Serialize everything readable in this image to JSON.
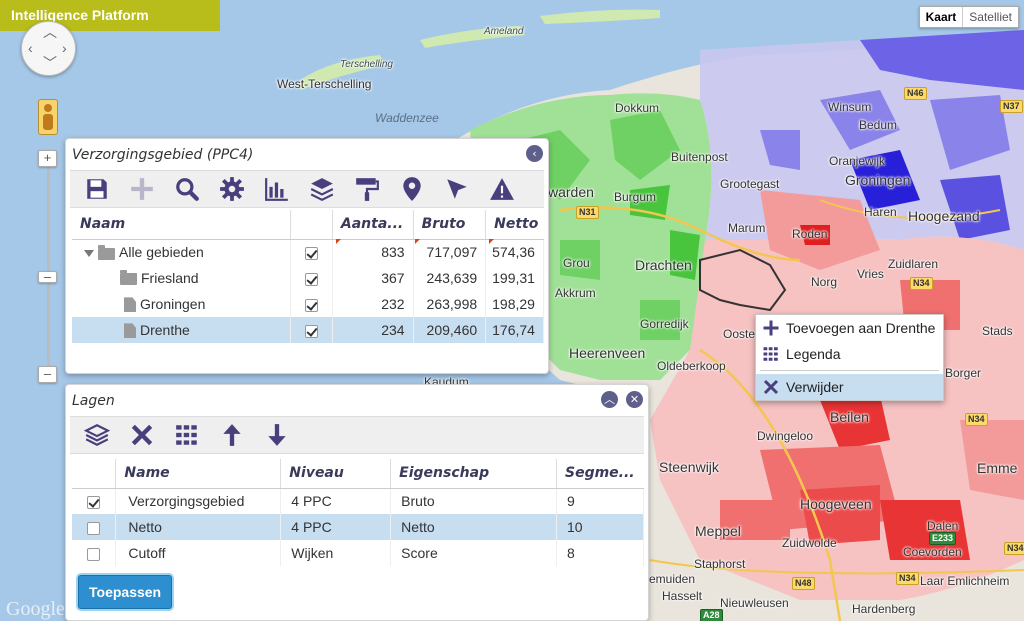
{
  "brand": "Intelligence Platform",
  "map_type": {
    "map": "Kaart",
    "satellite": "Satelliet",
    "selected": "Kaart"
  },
  "map_labels": {
    "ameland": "Ameland",
    "terschelling": "Terschelling",
    "west_terschelling": "West-Terschelling",
    "waddenzee": "Waddenzee",
    "dokkum": "Dokkum",
    "buitenpost": "Buitenpost",
    "grootegast": "Grootegast",
    "warden": "warden",
    "burgum": "Burgum",
    "drachten": "Drachten",
    "grou": "Grou",
    "akkrum": "Akkrum",
    "gorredijk": "Gorredijk",
    "heerenveen": "Heerenveen",
    "oldeberkoop": "Oldeberkoop",
    "kaudum": "Kaudum",
    "winsum": "Winsum",
    "bedum": "Bedum",
    "oranjewijk": "Oranjewijk",
    "groningen": "Groningen",
    "haren": "Haren",
    "hoogezand": "Hoogezand",
    "marum": "Marum",
    "roden": "Roden",
    "zuidlaren": "Zuidlaren",
    "vries": "Vries",
    "norg": "Norg",
    "stads": "Stads",
    "borger": "Borger",
    "beilen": "Beilen",
    "dwingeloo": "Dwingeloo",
    "steenwijk": "Steenwijk",
    "hoogeveen": "Hoogeveen",
    "emmen": "Emme",
    "dalen": "Dalen",
    "zuidwolde": "Zuidwolde",
    "meppel": "Meppel",
    "coevorden": "Coevorden",
    "staphorst": "Staphorst",
    "emuiden": "emuiden",
    "hasselt": "Hasselt",
    "nieuwleusen": "Nieuwleusen",
    "laar": "Laar Emlichheim",
    "hardenberg": "Hardenberg",
    "ooste": "Ooste",
    "google": "Google"
  },
  "roads": [
    "N31",
    "N46",
    "N34",
    "N34",
    "N34",
    "N48",
    "N34",
    "E233",
    "A28",
    "N37"
  ],
  "panel1": {
    "title": "Verzorgingsgebied (PPC4)",
    "tools": [
      "save-icon",
      "add-icon",
      "zoom-icon",
      "settings-icon",
      "chart-icon",
      "layers-icon",
      "paint-roller-icon",
      "marker-icon",
      "cursor-icon",
      "warning-icon"
    ],
    "columns": [
      "Naam",
      "",
      "Aanta...",
      "Bruto",
      "Netto"
    ],
    "rows": [
      {
        "name": "Alle gebieden",
        "type": "folder-open",
        "checked": true,
        "aantal": "833",
        "bruto": "717,097",
        "netto": "574,36"
      },
      {
        "name": "Friesland",
        "type": "folder",
        "checked": true,
        "aantal": "367",
        "bruto": "243,639",
        "netto": "199,31"
      },
      {
        "name": "Groningen",
        "type": "doc",
        "checked": true,
        "aantal": "232",
        "bruto": "263,998",
        "netto": "198,29"
      },
      {
        "name": "Drenthe",
        "type": "doc",
        "checked": true,
        "aantal": "234",
        "bruto": "209,460",
        "netto": "176,74",
        "selected": true
      }
    ]
  },
  "panel2": {
    "title": "Lagen",
    "tools": [
      "layers-icon",
      "delete-icon",
      "grid-icon",
      "arrow-up-icon",
      "arrow-down-icon"
    ],
    "columns": [
      "",
      "Name",
      "Niveau",
      "Eigenschap",
      "Segme..."
    ],
    "rows": [
      {
        "checked": true,
        "name": "Verzorgingsgebied",
        "niveau": "4 PPC",
        "eigenschap": "Bruto",
        "segments": "9"
      },
      {
        "checked": false,
        "name": "Netto",
        "niveau": "4 PPC",
        "eigenschap": "Netto",
        "segments": "10",
        "selected": true
      },
      {
        "checked": false,
        "name": "Cutoff",
        "niveau": "Wijken",
        "eigenschap": "Score",
        "segments": "8"
      }
    ],
    "apply": "Toepassen"
  },
  "context_menu": {
    "items": [
      {
        "label": "Toevoegen aan Drenthe",
        "icon": "plus-icon"
      },
      {
        "label": "Legenda",
        "icon": "grid-icon"
      },
      {
        "label": "Verwijder",
        "icon": "close-icon",
        "hover": true
      }
    ]
  },
  "colors": {
    "brand": "#b8bd1c",
    "icon": "#4a3f7d",
    "selection": "#c7ddf0",
    "button": "#2d8fd0",
    "sea": "#a6c8e8"
  }
}
